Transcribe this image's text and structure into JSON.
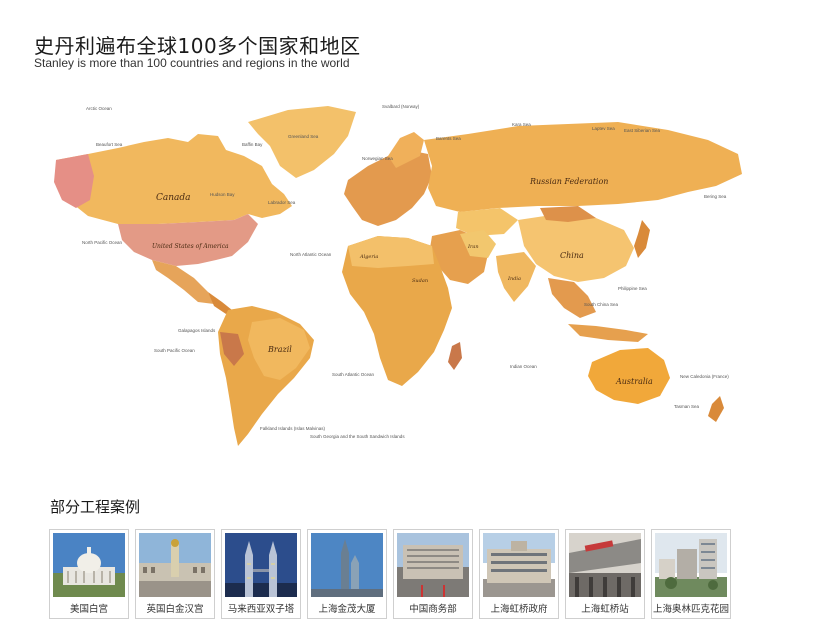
{
  "header": {
    "title_zh": "史丹利遍布全球100多个国家和地区",
    "title_en": "Stanley is more than 100 countries and regions in the world"
  },
  "map": {
    "country_labels": {
      "canada": "Canada",
      "usa": "United States of America",
      "russia": "Russian Federation",
      "china": "China",
      "brazil": "Brazil",
      "australia": "Australia",
      "iran": "Iran",
      "india": "India",
      "algeria": "Algeria",
      "sudan": "Sudan"
    },
    "ocean_labels": {
      "arctic": "Arctic Ocean",
      "beaufort": "Beaufort Sea",
      "baffin": "Baffin Bay",
      "greenland": "Greenland Sea",
      "svalbard": "Svalbard (Norway)",
      "barents": "Barents Sea",
      "kara": "Kara Sea",
      "laptev": "Laptev Sea",
      "east_siberian": "East Siberian Sea",
      "norwegian": "Norwegian Sea",
      "hudson": "Hudson Bay",
      "labrador": "Labrador Sea",
      "north_atlantic": "North Atlantic Ocean",
      "north_pacific": "North Pacific Ocean",
      "south_pacific": "South Pacific Ocean",
      "south_atlantic": "South Atlantic Ocean",
      "indian": "Indian Ocean",
      "bering": "Bering Sea",
      "philippine": "Philippine Sea",
      "south_china": "South China Sea",
      "tasman": "Tasman Sea",
      "galapagos": "Galapagos Islands",
      "falkland": "Falkland Islands (Islas Malvinas)",
      "south_georgia": "South Georgia and the South Sandwich Islands",
      "new_caledonia": "New Caledonia (France)"
    }
  },
  "cases_section": {
    "title": "部分工程案例",
    "items": [
      {
        "caption": "美国白宫"
      },
      {
        "caption": "英国白金汉宫"
      },
      {
        "caption": "马来西亚双子塔"
      },
      {
        "caption": "上海金茂大厦"
      },
      {
        "caption": "中国商务部"
      },
      {
        "caption": "上海虹桥政府"
      },
      {
        "caption": "上海虹桥站"
      },
      {
        "caption": "上海奥林匹克花园"
      }
    ]
  },
  "colors": {
    "map_light": "#f4c46a",
    "map_mid": "#e9a84a",
    "map_dark": "#d98a3a",
    "map_pink": "#e3a08a",
    "map_brown": "#b9774a",
    "frame_border": "#cfcfcf"
  }
}
